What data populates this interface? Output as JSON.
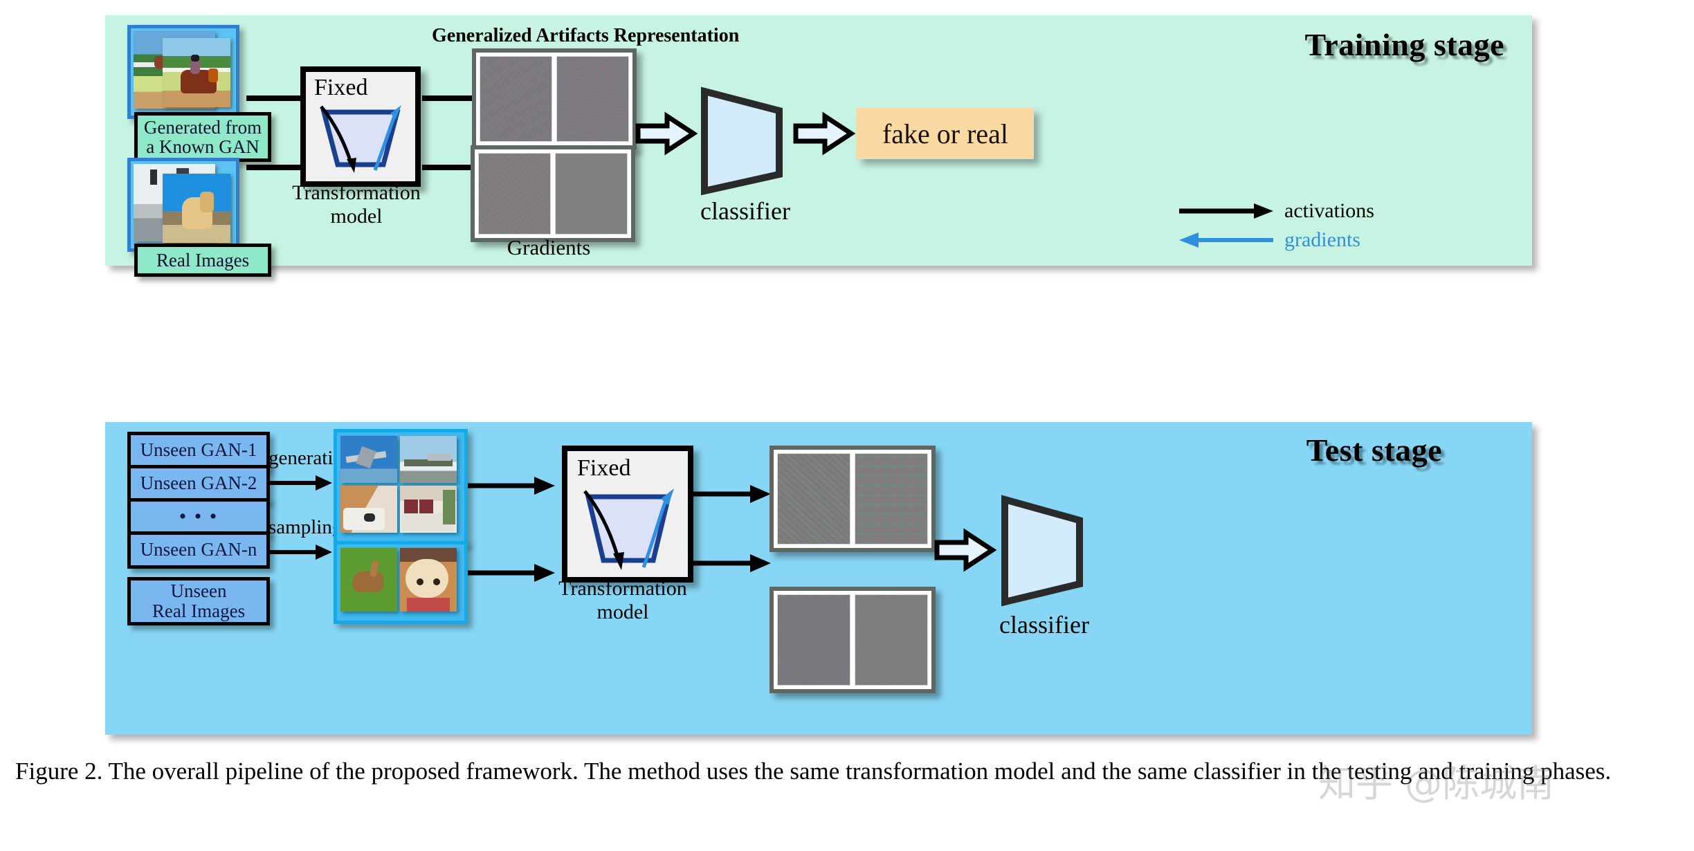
{
  "figure": {
    "caption": "Figure 2. The overall pipeline of the proposed framework. The method uses the same transformation model and the same classifier in the testing and training phases.",
    "watermark": "知乎 @陈城南"
  },
  "colors": {
    "training_panel_bg": "#c6f3e2",
    "test_panel_bg": "#87d6f5",
    "label_box_bg": "#8fe8c8",
    "gan_box_bg": "#7ab6f0",
    "classifier_fill": "#d3ecfb",
    "output_box_bg": "#fbd9a2",
    "activation_arrow": "#000000",
    "gradient_arrow": "#2f8fe0",
    "model_trapezoid_stroke": "#1b3f8f",
    "model_trapezoid_fill": "#dbe2f7"
  },
  "training_stage": {
    "title": "Training stage",
    "inputs": [
      {
        "label": "Generated from\na Known GAN",
        "name": "generated-known-gan"
      },
      {
        "label": "Real Images",
        "name": "real-images"
      }
    ],
    "transformation_model": {
      "fixed_label": "Fixed",
      "caption": "Transformation\nmodel"
    },
    "artifacts_title": "Generalized Artifacts Representation",
    "gradients_label": "Gradients",
    "classifier_label": "classifier",
    "output_label": "fake or real",
    "legend": [
      {
        "label": "activations",
        "direction": "right",
        "color": "#000000"
      },
      {
        "label": "gradients",
        "direction": "left",
        "color": "#2f8fe0"
      }
    ]
  },
  "test_stage": {
    "title": "Test stage",
    "sources": [
      {
        "label": "Unseen GAN-1"
      },
      {
        "label": "Unseen GAN-2"
      },
      {
        "label": "•  •  •"
      },
      {
        "label": "Unseen GAN-n"
      },
      {
        "label": "Unseen\nReal Images"
      }
    ],
    "edge_labels": [
      {
        "label": "generating"
      },
      {
        "label": "sampling"
      }
    ],
    "transformation_model": {
      "fixed_label": "Fixed",
      "caption": "Transformation\nmodel"
    },
    "classifier_label": "classifier"
  }
}
